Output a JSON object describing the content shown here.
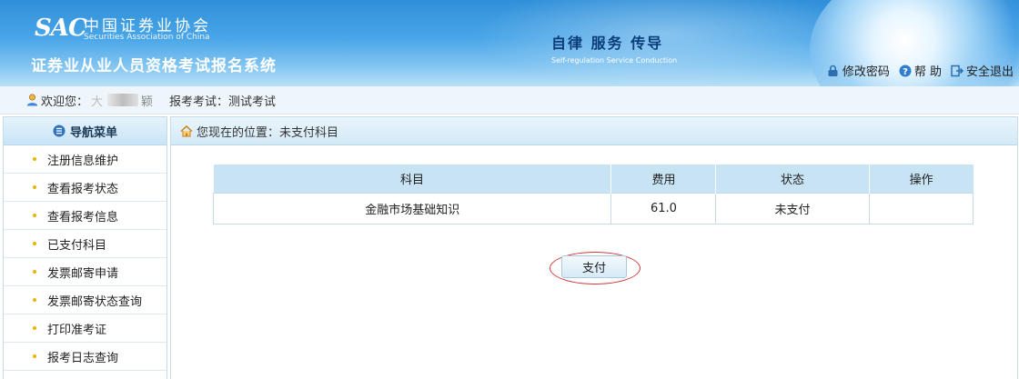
{
  "header": {
    "logo_abbr": "SAC",
    "logo_cn": "中国证券业协会",
    "logo_en": "Securities Association of China",
    "system_title": "证券业从业人员资格考试报名系统",
    "slogan_cn": "自律  服务  传导",
    "slogan_en": "Self-regulation  Service  Conduction",
    "links": {
      "change_password": "修改密码",
      "help": "帮 助",
      "logout": "安全退出"
    }
  },
  "userbar": {
    "welcome": "欢迎您：",
    "username_partial": "大",
    "username_suffix": "颖",
    "exam_label": "报考考试：测试考试"
  },
  "sidebar": {
    "title": "导航菜单",
    "items": [
      {
        "label": "注册信息维护"
      },
      {
        "label": "查看报考状态"
      },
      {
        "label": "查看报考信息"
      },
      {
        "label": "已支付科目"
      },
      {
        "label": "发票邮寄申请"
      },
      {
        "label": "发票邮寄状态查询"
      },
      {
        "label": "打印准考证"
      },
      {
        "label": "报考日志查询"
      }
    ]
  },
  "main": {
    "breadcrumb": "您现在的位置：未支付科目",
    "table": {
      "headers": [
        "科目",
        "费用",
        "状态",
        "操作"
      ],
      "rows": [
        {
          "subject": "金融市场基础知识",
          "fee": "61.0",
          "status": "未支付",
          "action": ""
        }
      ]
    },
    "pay_button": "支付"
  },
  "colors": {
    "header_blue": "#2f8fd9",
    "table_header": "#c7e3f4",
    "highlight_red": "#d23a3a"
  }
}
